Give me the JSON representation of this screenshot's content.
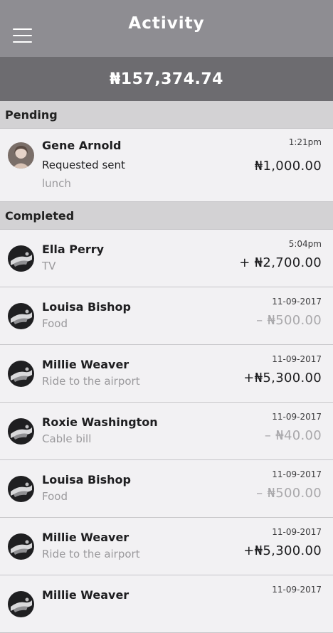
{
  "header": {
    "title": "Activity"
  },
  "balance": "₦157,374.74",
  "sections": {
    "pending": "Pending",
    "completed": "Completed"
  },
  "pending_item": {
    "name": "Gene Arnold",
    "status": "Requested sent",
    "note": "lunch",
    "time": "1:21pm",
    "amount": "₦1,000.00"
  },
  "completed_items": [
    {
      "name": "Ella Perry",
      "note": "TV",
      "time": "5:04pm",
      "amount": "+ ₦2,700.00"
    },
    {
      "name": "Louisa Bishop",
      "note": "Food",
      "time": "11-09-2017",
      "amount": "– ₦500.00"
    },
    {
      "name": "Millie Weaver",
      "note": "Ride to the airport",
      "time": "11-09-2017",
      "amount": "+₦5,300.00"
    },
    {
      "name": "Roxie Washington",
      "note": "Cable bill",
      "time": "11-09-2017",
      "amount": "– ₦40.00"
    },
    {
      "name": "Louisa Bishop",
      "note": "Food",
      "time": "11-09-2017",
      "amount": "– ₦500.00"
    },
    {
      "name": "Millie Weaver",
      "note": "Ride to the airport",
      "time": "11-09-2017",
      "amount": "+₦5,300.00"
    },
    {
      "name": "Millie Weaver",
      "note": "",
      "time": "11-09-2017",
      "amount": ""
    }
  ],
  "colors": {
    "header_bg": "#8e8d92",
    "balance_bg": "#6d6c70",
    "section_bg": "#d3d2d4",
    "row_bg": "#f2f1f3",
    "negative_amount": "#a9a8ab"
  }
}
